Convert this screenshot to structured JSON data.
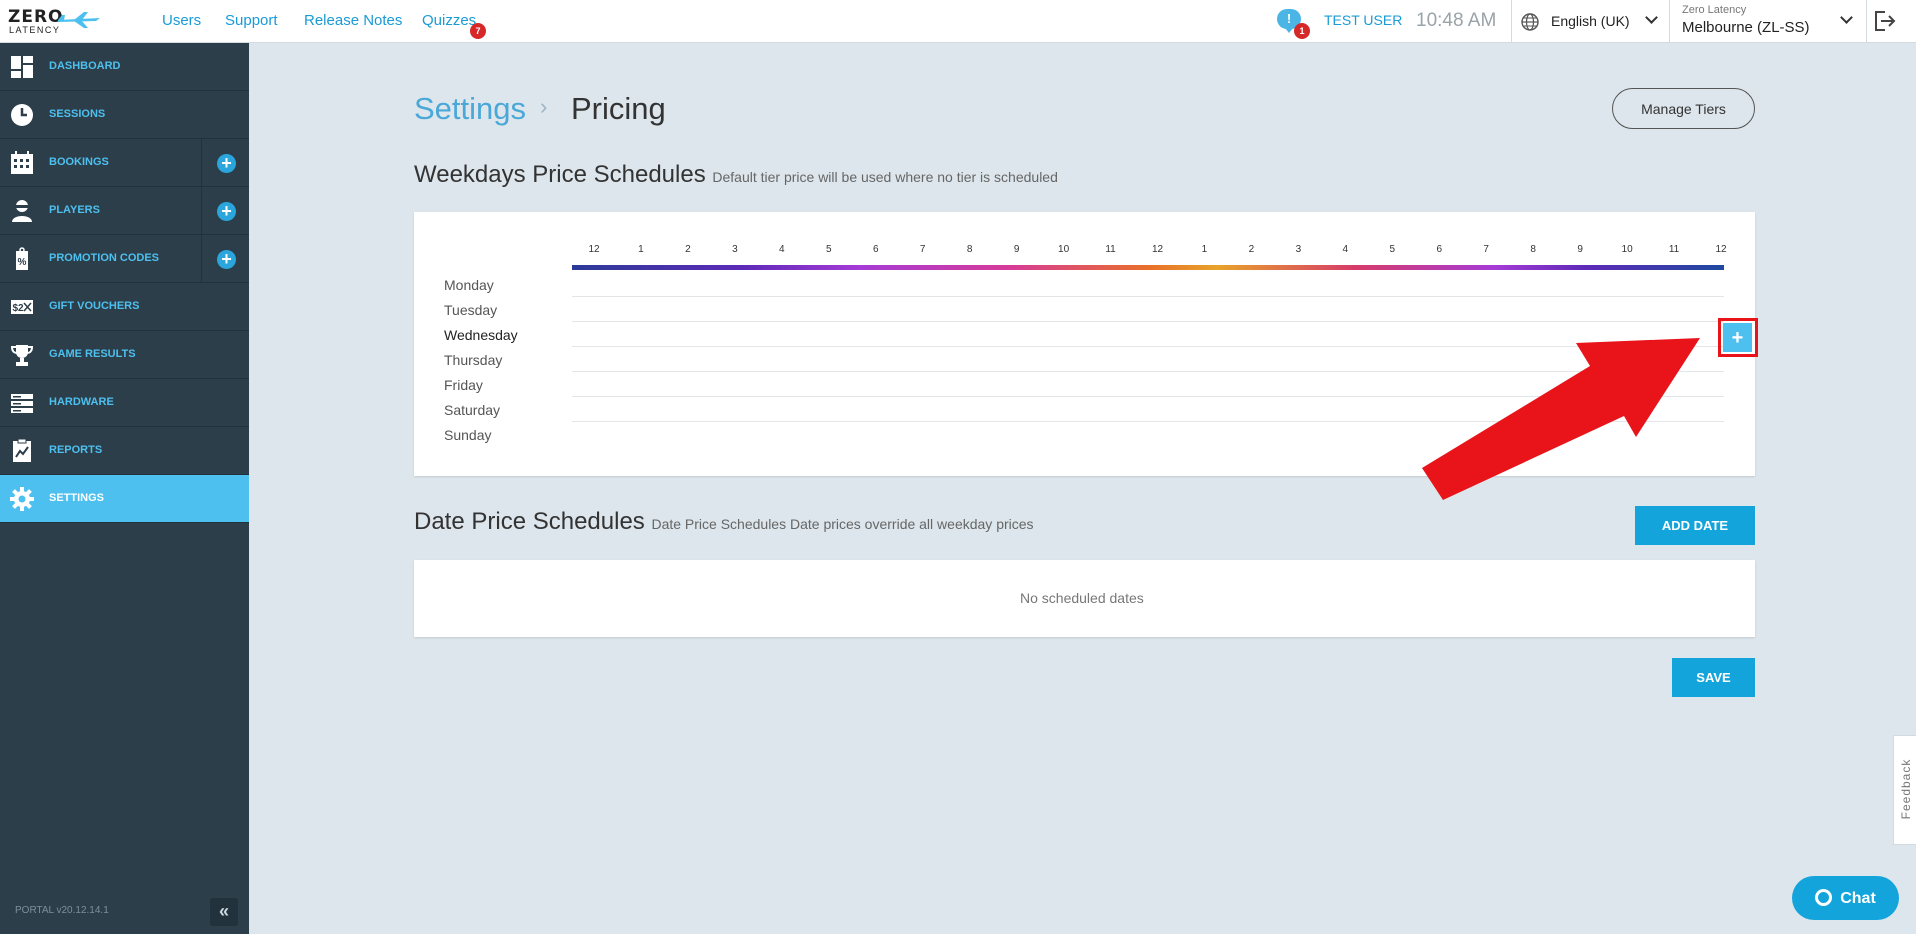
{
  "header": {
    "logo_line1": "ZERO",
    "logo_line2": "LATENCY",
    "nav": [
      "Users",
      "Support",
      "Release Notes",
      "Quizzes"
    ],
    "quizzes_badge": "7",
    "notifications_badge": "1",
    "notification_glyph": "!",
    "user": "TEST USER",
    "time": "10:48 AM",
    "language": "English (UK)",
    "location_org": "Zero Latency",
    "location": "Melbourne (ZL-SS)"
  },
  "sidebar": {
    "items": [
      {
        "label": "DASHBOARD",
        "icon": "dashboard-icon"
      },
      {
        "label": "SESSIONS",
        "icon": "clock-icon"
      },
      {
        "label": "BOOKINGS",
        "icon": "calendar-icon"
      },
      {
        "label": "PLAYERS",
        "icon": "player-icon"
      },
      {
        "label": "PROMOTION CODES",
        "icon": "promo-tag-icon"
      },
      {
        "label": "GIFT VOUCHERS",
        "icon": "voucher-icon"
      },
      {
        "label": "GAME RESULTS",
        "icon": "trophy-icon"
      },
      {
        "label": "HARDWARE",
        "icon": "server-icon"
      },
      {
        "label": "REPORTS",
        "icon": "report-icon"
      },
      {
        "label": "SETTINGS",
        "icon": "gear-icon"
      }
    ],
    "plus_glyph": "+",
    "version": "PORTAL v20.12.14.1",
    "collapse_glyph": "«"
  },
  "main": {
    "breadcrumb": {
      "parent": "Settings",
      "separator": "›",
      "current": "Pricing"
    },
    "manage_tiers_label": "Manage Tiers",
    "weekdays": {
      "title": "Weekdays Price Schedules",
      "subtitle": "Default tier price will be used where no tier is scheduled",
      "hours": [
        "12",
        "1",
        "2",
        "3",
        "4",
        "5",
        "6",
        "7",
        "8",
        "9",
        "10",
        "11",
        "12",
        "1",
        "2",
        "3",
        "4",
        "5",
        "6",
        "7",
        "8",
        "9",
        "10",
        "11",
        "12"
      ],
      "days": [
        "Monday",
        "Tuesday",
        "Wednesday",
        "Thursday",
        "Friday",
        "Saturday",
        "Sunday"
      ],
      "add_glyph": "+"
    },
    "dates": {
      "title": "Date Price Schedules",
      "subtitle": "Date Price Schedules Date prices override all weekday prices",
      "add_date_label": "ADD DATE",
      "empty": "No scheduled dates"
    },
    "save_label": "SAVE"
  },
  "widgets": {
    "feedback": "Feedback",
    "chat": "Chat"
  },
  "colors": {
    "accent": "#14a4dc",
    "sidebar_bg": "#2c3e4a",
    "sidebar_active": "#4dc0ef",
    "annotation_red": "#e8141a"
  }
}
